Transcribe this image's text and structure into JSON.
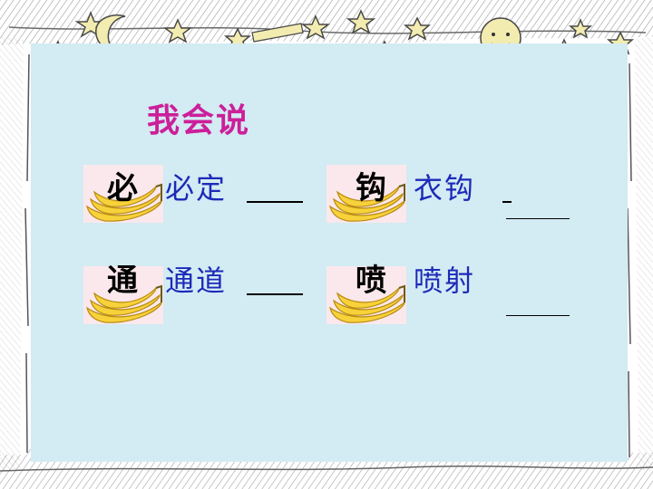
{
  "title": "我会说",
  "items": [
    {
      "char": "必",
      "word": "必定"
    },
    {
      "char": "钩",
      "word": "衣钩"
    },
    {
      "char": "通",
      "word": "通道"
    },
    {
      "char": "喷",
      "word": "喷射"
    }
  ],
  "colors": {
    "title": "#cc1f9a",
    "word": "#1c2ab8",
    "panel": "#d3ebf3",
    "card": "#fbe8ec"
  },
  "decorations": [
    "star-icon",
    "moon-icon",
    "shooting-star-icon",
    "smiley-sun-icon",
    "city-skyline",
    "banana-icon"
  ]
}
